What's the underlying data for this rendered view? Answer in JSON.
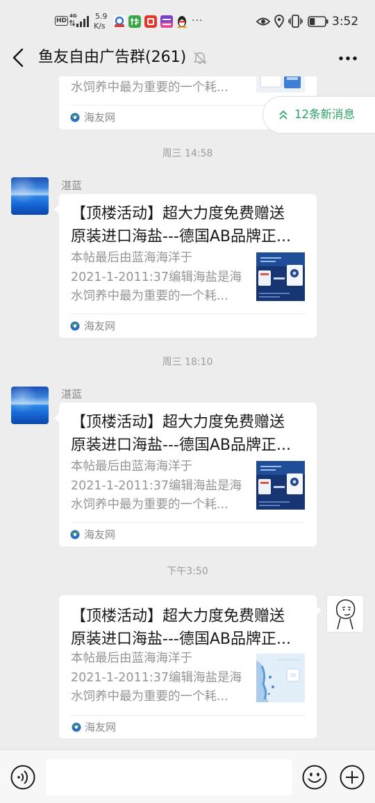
{
  "status_bar": {
    "hd_badge": "HD",
    "network": "4G",
    "speed_value": "5.9",
    "speed_unit": "K/s",
    "overflow": "···",
    "time": "3:52",
    "battery_level": 0.35
  },
  "header": {
    "title": "鱼友自由广告群(261)"
  },
  "new_messages": {
    "label": "12条新消息",
    "color": "#2ba365"
  },
  "partial_card": {
    "desc_line": "水饲养中最为重要的一个耗...",
    "source": "海友网"
  },
  "messages": [
    {
      "timestamp": "周三 14:58",
      "sender": "湛蓝",
      "title_lines": [
        "【顶楼活动】超大力度免费赠送",
        "原装进口海盐---德国AB品牌正..."
      ],
      "desc_lines": [
        "本帖最后由蓝海海洋于",
        "2021-1-2011:37编辑海盐是海",
        "水饲养中最为重要的一个耗..."
      ],
      "source": "海友网"
    },
    {
      "timestamp": "周三 18:10",
      "sender": "湛蓝",
      "title_lines": [
        "【顶楼活动】超大力度免费赠送",
        "原装进口海盐---德国AB品牌正..."
      ],
      "desc_lines": [
        "本帖最后由蓝海海洋于",
        "2021-1-2011:37编辑海盐是海",
        "水饲养中最为重要的一个耗..."
      ],
      "source": "海友网"
    },
    {
      "timestamp": "下午3:50",
      "title_lines": [
        "【顶楼活动】超大力度免费赠送",
        "原装进口海盐---德国AB品牌正..."
      ],
      "desc_lines": [
        "本帖最后由蓝海海洋于",
        "2021-1-2011:37编辑海盐是海",
        "水饲养中最为重要的一个耗..."
      ],
      "source": "海友网"
    }
  ],
  "icons": {
    "back": "back-arrow-icon",
    "mute": "mute-bell-icon",
    "more": "more-icon",
    "voice": "voice-icon",
    "emoji": "emoji-icon",
    "plus": "plus-icon"
  },
  "colors": {
    "background": "#ededed",
    "card": "#ffffff",
    "accent": "#2ba365"
  }
}
